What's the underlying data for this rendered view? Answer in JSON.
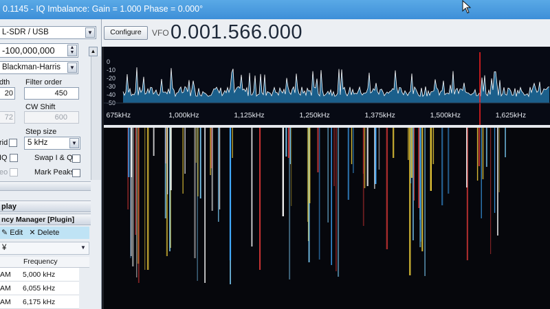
{
  "window": {
    "title": "0.1145 - IQ Imbalance: Gain = 1.000 Phase = 0.000°"
  },
  "left_panel": {
    "source_select": "L-SDR / USB",
    "frequency_shift": "-100,000,000",
    "window_select": "Blackman-Harris",
    "bandwidth_label": "dth",
    "bandwidth_value": "20",
    "filter_order_label": "Filter order",
    "filter_order_value": "450",
    "shift_value": "72",
    "cw_shift_label": "CW Shift",
    "cw_shift_value": "600",
    "step_size_label": "Step size",
    "step_size_value": "5 kHz",
    "snap_label": "rid",
    "swap_label": "Swap I & Q",
    "iq_label": "IQ",
    "correct_label": "eo",
    "mark_peaks_label": "Mark Peaks",
    "section_display": "play",
    "section_freq_manager": "ncy Manager [Plugin]",
    "edit_label": "Edit",
    "delete_label": "Delete",
    "group_select": "¥",
    "grid_header_frequency": "Frequency",
    "rows": [
      {
        "mode": "AM",
        "frequency": "5,000 kHz"
      },
      {
        "mode": "AM",
        "frequency": "6,055 kHz"
      },
      {
        "mode": "AM",
        "frequency": "6,175 kHz"
      }
    ]
  },
  "top_bar": {
    "configure_label": "Configure",
    "vfo_label": "VFO",
    "vfo_value": "0.001.566.000"
  },
  "spectrum": {
    "y_ticks": [
      "0",
      "-10",
      "-20",
      "-30",
      "-40",
      "-50"
    ],
    "x_ticks": [
      "675kHz",
      "1,000kHz",
      "1,125kHz",
      "1,250kHz",
      "1,375kHz",
      "1,500kHz",
      "1,625kHz"
    ],
    "x_tick_values_khz": [
      875,
      1000,
      1125,
      1250,
      1375,
      1500,
      1625
    ],
    "x_range_khz": [
      847,
      1700
    ],
    "y_range_db": [
      -50,
      5
    ],
    "tuned_khz": 1566,
    "colors": {
      "trace": "#ffffff",
      "fill": "#1e6fa0",
      "marker": "#ff2020",
      "waterfall_bg": "#06070c"
    }
  }
}
